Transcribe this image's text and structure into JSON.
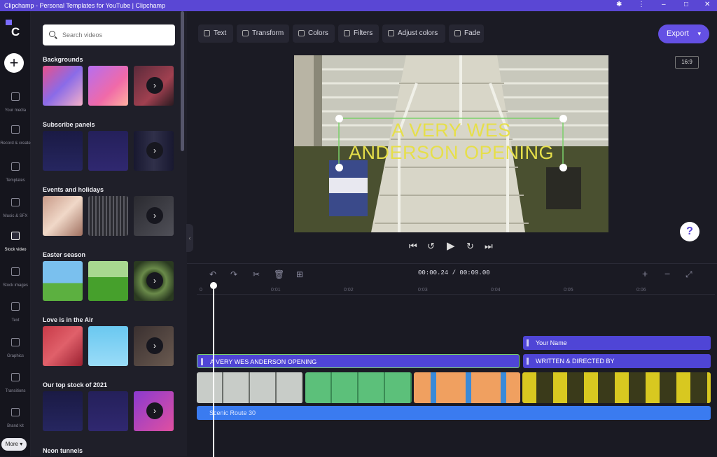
{
  "window": {
    "title": "Clipchamp - Personal Templates for YouTube | Clipchamp"
  },
  "rail": {
    "logo": "C",
    "items": [
      {
        "label": "Your media"
      },
      {
        "label": "Record & create"
      },
      {
        "label": "Templates"
      },
      {
        "label": "Music & SFX"
      },
      {
        "label": "Stock video"
      },
      {
        "label": "Stock images"
      },
      {
        "label": "Text"
      },
      {
        "label": "Graphics"
      },
      {
        "label": "Transitions"
      },
      {
        "label": "Brand kit"
      }
    ],
    "more_label": "More"
  },
  "panel": {
    "search_placeholder": "Search videos",
    "sections": [
      {
        "title": "Backgrounds"
      },
      {
        "title": "Subscribe panels"
      },
      {
        "title": "Events and holidays"
      },
      {
        "title": "Easter season"
      },
      {
        "title": "Love is in the Air"
      },
      {
        "title": "Our top stock of 2021"
      },
      {
        "title": "Neon tunnels"
      }
    ]
  },
  "toolbar": {
    "items": [
      {
        "label": "Text",
        "icon": "text-icon"
      },
      {
        "label": "Transform",
        "icon": "transform-icon"
      },
      {
        "label": "Colors",
        "icon": "palette-icon"
      },
      {
        "label": "Filters",
        "icon": "wand-icon"
      },
      {
        "label": "Adjust colors",
        "icon": "contrast-icon"
      },
      {
        "label": "Fade",
        "icon": "fade-icon"
      }
    ],
    "export_label": "Export"
  },
  "preview": {
    "aspect_ratio": "16:9",
    "overlay_line1": "A VERY WES",
    "overlay_line2": "ANDERSON OPENING"
  },
  "timeline": {
    "current_time": "00:00.24",
    "total_time": "00:09.00",
    "ruler_ticks": [
      "0",
      "0:01",
      "0:02",
      "0:03",
      "0:04",
      "0:05",
      "0:06"
    ],
    "text_clips": [
      {
        "label": "Your Name"
      },
      {
        "label": "A VERY WES ANDERSON OPENING"
      },
      {
        "label": "WRITTEN & DIRECTED BY"
      }
    ],
    "audio_clip": "Scenic Route 30"
  },
  "colors": {
    "accent": "#5a47d4",
    "export": "#6450e4",
    "text_clip": "#4f45d6",
    "audio": "#3a7bf0",
    "overlay_text": "#e6df4a"
  }
}
